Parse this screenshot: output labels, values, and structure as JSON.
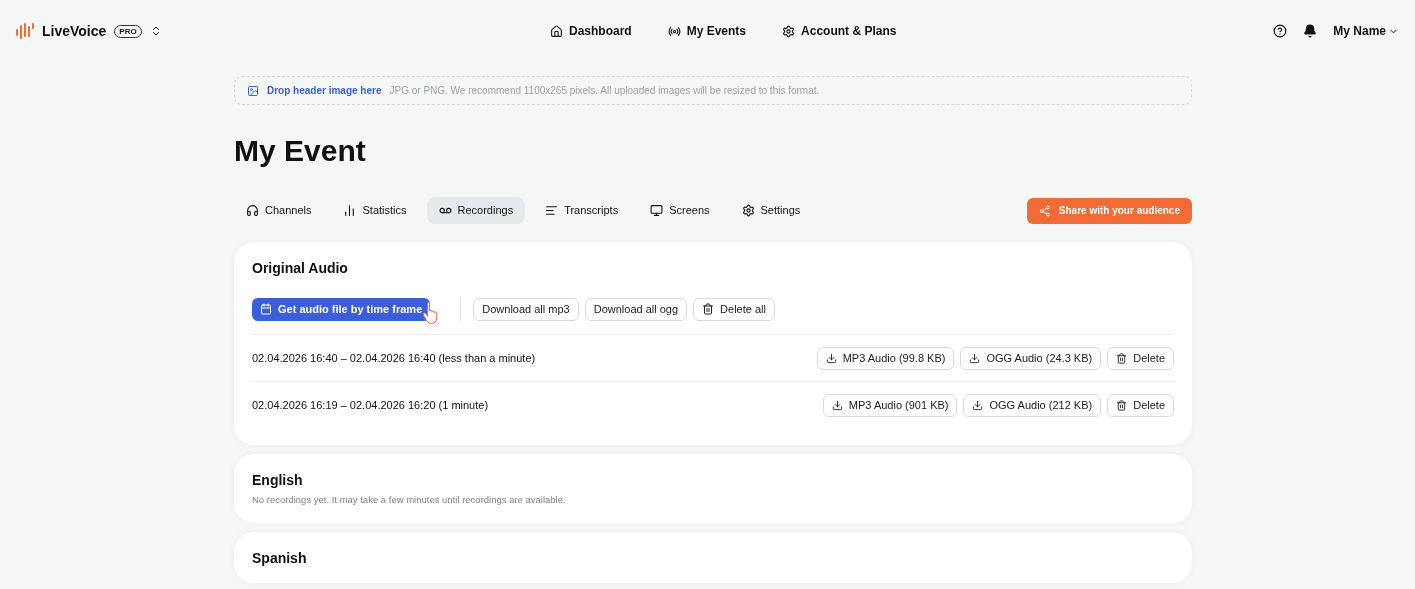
{
  "brand": {
    "name": "LiveVoice",
    "badge": "PRO"
  },
  "nav": [
    {
      "label": "Dashboard"
    },
    {
      "label": "My Events"
    },
    {
      "label": "Account & Plans"
    }
  ],
  "user": {
    "name": "My Name"
  },
  "dropzone": {
    "link": "Drop header image here",
    "hint": "JPG or PNG. We recommend 1100x265 pixels. All uploaded images will be resized to this format."
  },
  "title": "My Event",
  "tabs": [
    {
      "label": "Channels",
      "selected": false
    },
    {
      "label": "Statistics",
      "selected": false
    },
    {
      "label": "Recordings",
      "selected": true
    },
    {
      "label": "Transcripts",
      "selected": false
    },
    {
      "label": "Screens",
      "selected": false
    },
    {
      "label": "Settings",
      "selected": false
    }
  ],
  "share_button": "Share with your audience",
  "sections": [
    {
      "title": "Original Audio",
      "actions": [
        {
          "label": "Get audio file by time frame",
          "kind": "primary"
        },
        {
          "label": "Download all mp3",
          "kind": "plain"
        },
        {
          "label": "Download all ogg",
          "kind": "plain"
        },
        {
          "label": "Delete all",
          "kind": "delete"
        }
      ],
      "recordings": [
        {
          "range": "02.04.2026 16:40 – 02.04.2026 16:40 (less than a minute)",
          "mp3": "MP3 Audio (99.8 KB)",
          "ogg": "OGG Audio (24.3 KB)",
          "delete": "Delete"
        },
        {
          "range": "02.04.2026 16:19 – 02.04.2026 16:20 (1 minute)",
          "mp3": "MP3 Audio (901 KB)",
          "ogg": "OGG Audio (212 KB)",
          "delete": "Delete"
        }
      ]
    },
    {
      "title": "English",
      "empty": "No recordings yet. It may take a few minutes until recordings are available."
    },
    {
      "title": "Spanish"
    }
  ]
}
